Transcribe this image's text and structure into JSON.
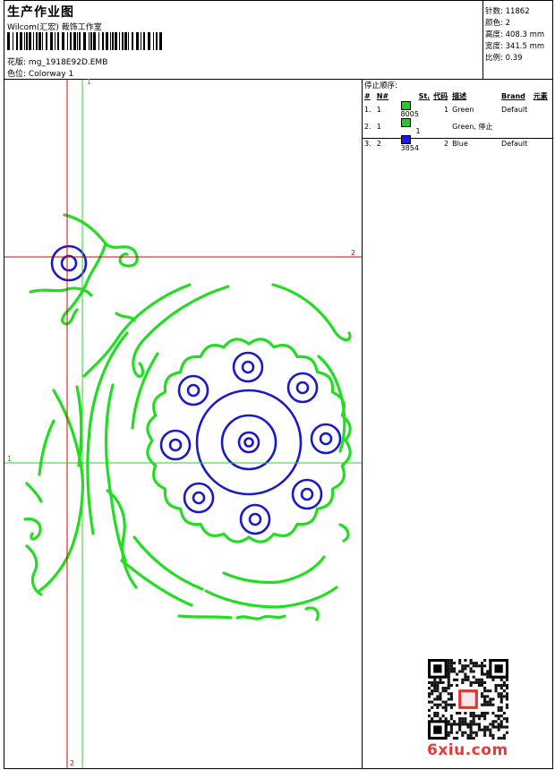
{
  "header": {
    "title": "生产作业图",
    "company": "Wilcom(汇宏) 裁饰工作室",
    "design_label": "花版:",
    "design_value": "mg_1918E92D.EMB",
    "colorway_label": "色位:",
    "colorway_value": "Colorway 1"
  },
  "stats": [
    {
      "label": "针数:",
      "value": "11862"
    },
    {
      "label": "颜色:",
      "value": "2"
    },
    {
      "label": "高度:",
      "value": "408.3 mm"
    },
    {
      "label": "宽度:",
      "value": "341.5 mm"
    },
    {
      "label": "比例:",
      "value": "0.39"
    }
  ],
  "stop_sequence": {
    "title": "停止顺序:",
    "headers": [
      "#",
      "N#",
      "St.",
      "代码",
      "描述",
      "Brand",
      "元素"
    ],
    "rows": [
      {
        "no": "1.",
        "n": "1",
        "swatch": "#22cc22",
        "st": "8005",
        "code": "1",
        "desc": "Green",
        "brand": "Default"
      },
      {
        "no": "2.",
        "n": "1",
        "swatch": "#22cc22",
        "st": "1",
        "code": "",
        "desc": "Green, 停止",
        "brand": ""
      },
      {
        "no": "3.",
        "n": "2",
        "swatch": "#1a1aee",
        "st": "3854",
        "code": "2",
        "desc": "Blue",
        "brand": "Default"
      }
    ]
  },
  "guides": {
    "top_v_green": "1",
    "right_h_red": "2",
    "left_h_green": "1",
    "bottom_v_red": "2"
  },
  "colors": {
    "green": "#22dd22",
    "blue": "#1a1acc",
    "red": "#dd0000",
    "guide_green": "#33cc33"
  },
  "watermark": "6xiu.com"
}
